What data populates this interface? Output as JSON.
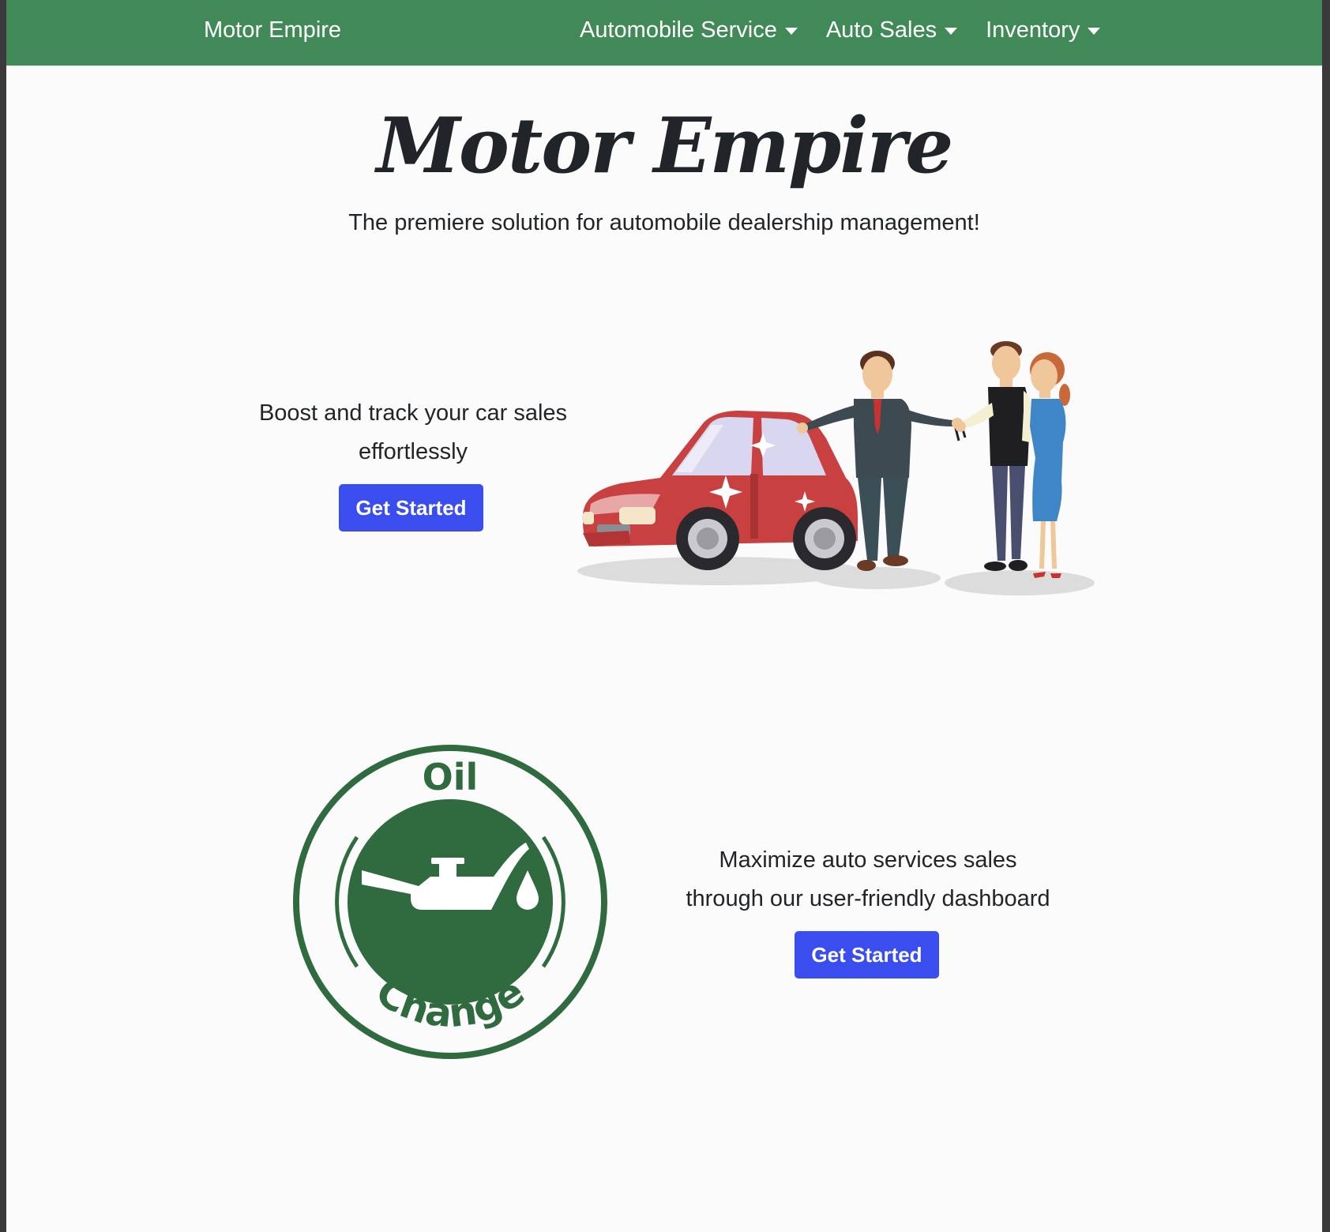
{
  "navbar": {
    "brand": "Motor Empire",
    "items": [
      {
        "label": "Automobile Service"
      },
      {
        "label": "Auto Sales"
      },
      {
        "label": "Inventory"
      }
    ]
  },
  "hero": {
    "title": "Motor Empire",
    "subtitle": "The premiere solution for automobile dealership management!"
  },
  "feature_sales": {
    "line1": "Boost and track your car sales",
    "line2": "effortlessly",
    "button": "Get Started"
  },
  "feature_services": {
    "line1": "Maximize auto services sales",
    "line2": "through our user-friendly dashboard",
    "button": "Get Started"
  },
  "oil_badge": {
    "top_text": "Oil",
    "bottom_text": "Change"
  },
  "colors": {
    "navbar": "#428958",
    "button": "#3a4ef0",
    "badge_green": "#306b3f",
    "car_red": "#c94040"
  }
}
